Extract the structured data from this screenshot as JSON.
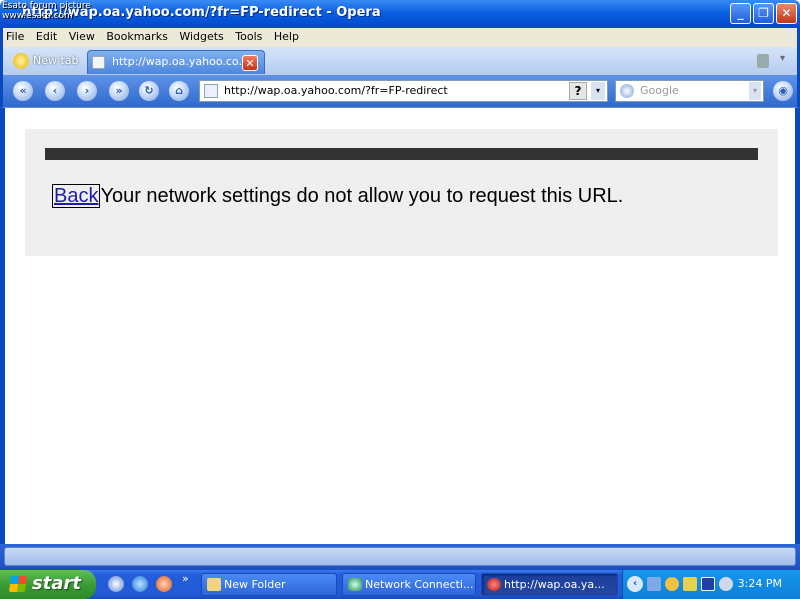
{
  "watermark": {
    "line1": "Esato forum picture",
    "line2": "www.esato.com"
  },
  "window": {
    "title": "http://wap.oa.yahoo.com/?fr=FP-redirect - Opera",
    "minimize_glyph": "_",
    "maximize_glyph": "❐",
    "close_glyph": "✕"
  },
  "menu": [
    "File",
    "Edit",
    "View",
    "Bookmarks",
    "Widgets",
    "Tools",
    "Help"
  ],
  "tabs": {
    "new_tab_label": "New tab",
    "active_label": "http://wap.oa.yahoo.co...",
    "close_glyph": "✕"
  },
  "toolbar": {
    "address": "http://wap.oa.yahoo.com/?fr=FP-redirect",
    "help_glyph": "?",
    "search_placeholder": "Google"
  },
  "page": {
    "back_link": "Back",
    "message": "Your network settings do not allow you to request this URL."
  },
  "taskbar": {
    "start_label": "start",
    "chevron": "»",
    "tasks": [
      "New Folder",
      "Network Connecti...",
      "http://wap.oa.ya..."
    ],
    "clock": "3:24 PM"
  },
  "colors": {
    "title_bar": "#0a5fe0",
    "content_panel": "#efefef",
    "link": "#1c1ca8",
    "taskbar": "#245edb",
    "start_button": "#3a9c34"
  }
}
